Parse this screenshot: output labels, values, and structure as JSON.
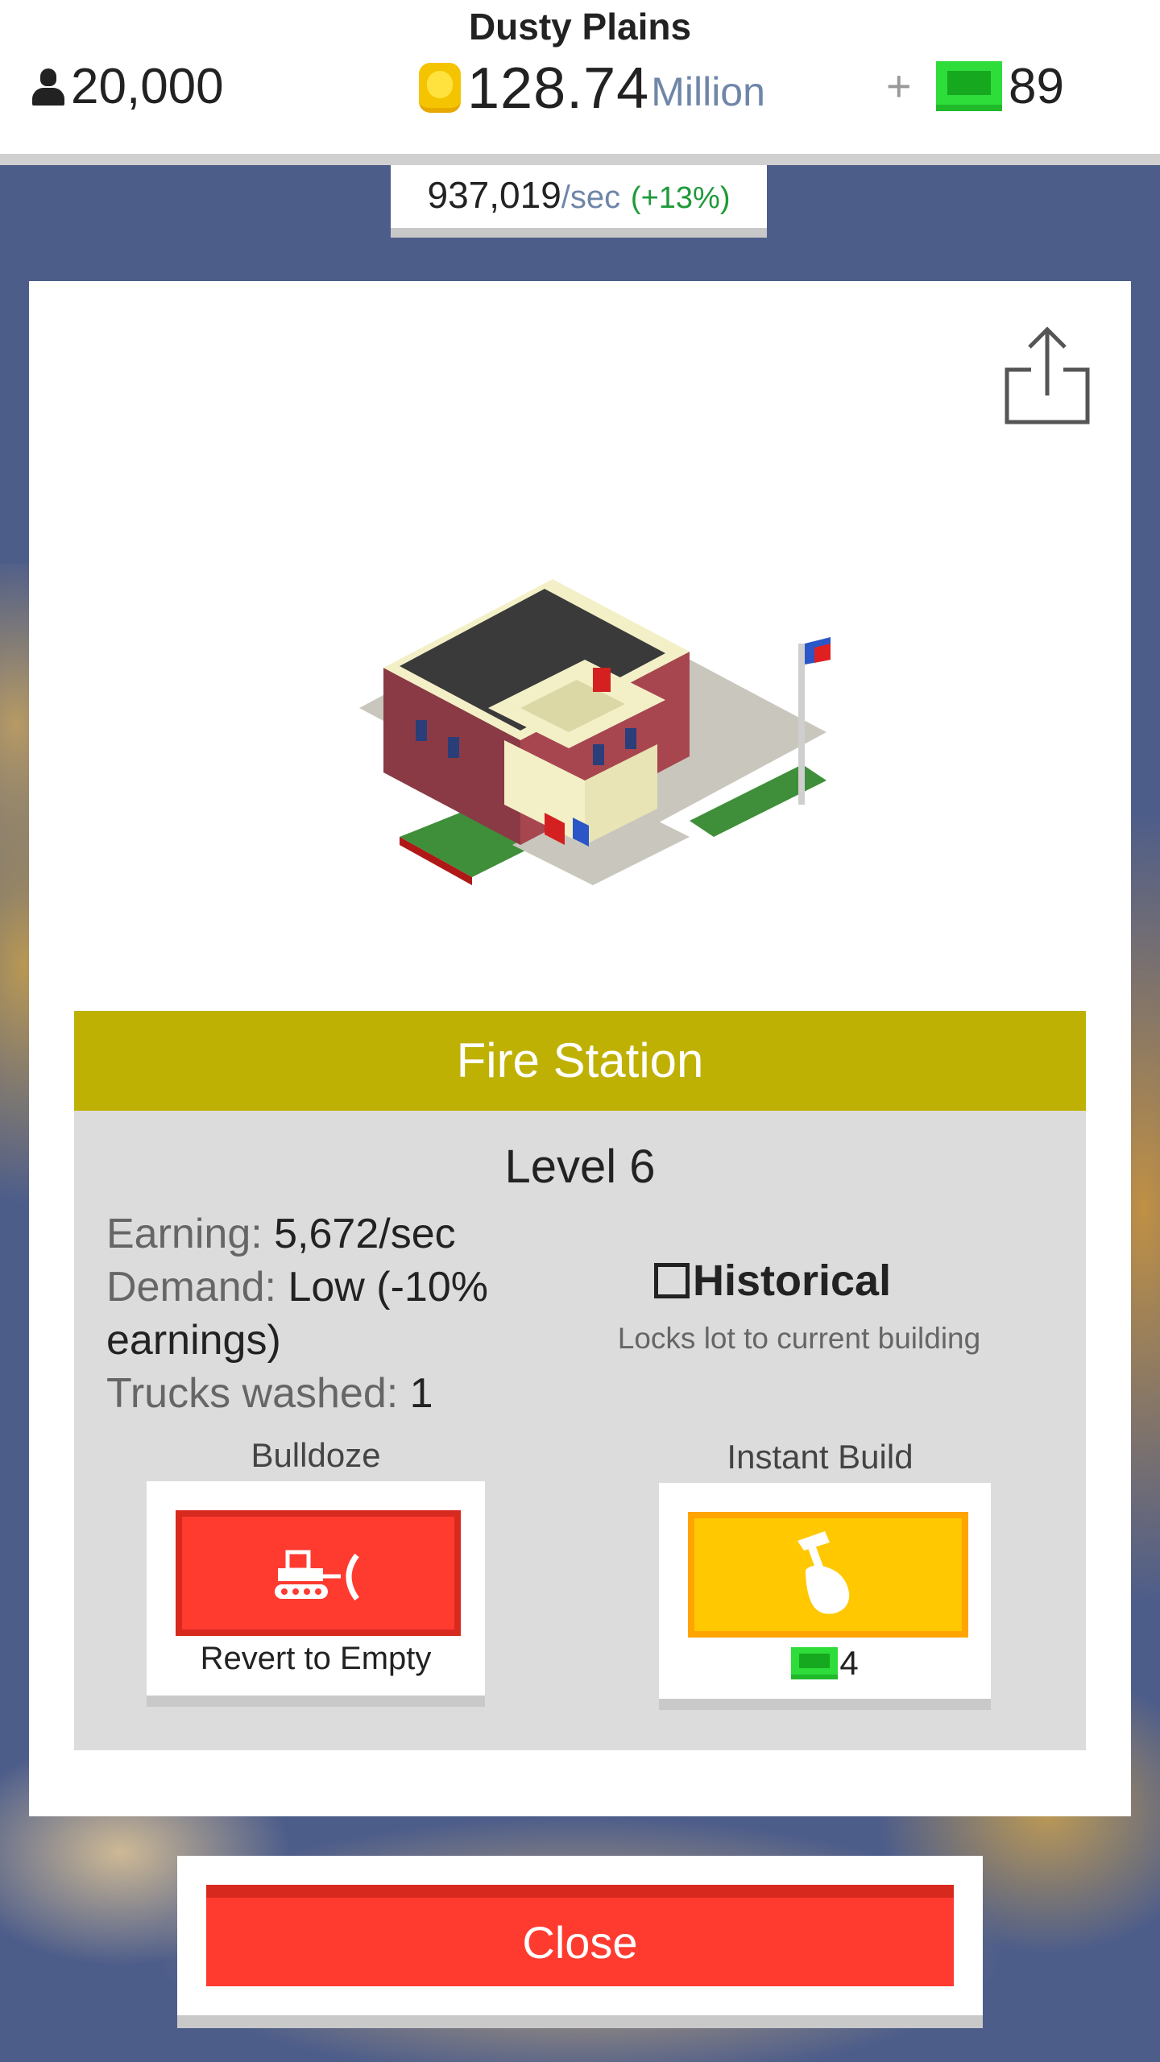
{
  "header": {
    "city_name": "Dusty Plains",
    "population": "20,000",
    "money_amount": "128.74",
    "money_unit": "Million",
    "plus": "+",
    "bucks": "89",
    "rate_amount": "937,019",
    "rate_unit": "/sec",
    "rate_bonus": "(+13%)"
  },
  "building": {
    "name": "Fire Station",
    "level": "Level 6",
    "earning_label": "Earning:",
    "earning_value": "5,672/sec",
    "demand_label": "Demand:",
    "demand_value": "Low (-10% earnings)",
    "trucks_label": "Trucks washed:",
    "trucks_value": "1",
    "historical_label": "Historical",
    "historical_checked": false,
    "historical_desc": "Locks lot to current building"
  },
  "actions": {
    "bulldoze_label": "Bulldoze",
    "bulldoze_button_text": "Revert to Empty",
    "instant_label": "Instant Build",
    "instant_cost": "4"
  },
  "close_label": "Close",
  "icons": {
    "population": "person-icon",
    "money": "coin-icon",
    "premium": "cash-icon",
    "share": "share-icon",
    "bulldoze": "bulldozer-icon",
    "instant": "hammer-hand-icon"
  },
  "colors": {
    "title_bar": "#bfb104",
    "bulldoze": "#ff3b30",
    "instant_build": "#ffc800",
    "close": "#ff3b30",
    "cash": "#2edc3a",
    "rate_bonus": "#1f9a3a"
  }
}
